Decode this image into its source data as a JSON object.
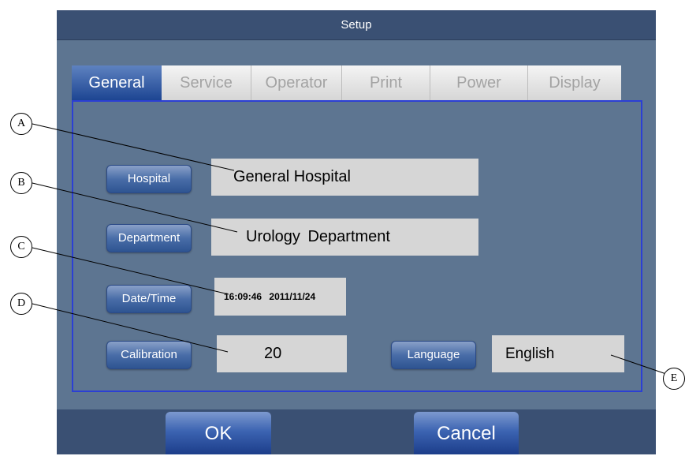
{
  "window": {
    "title": "Setup"
  },
  "tabs": [
    {
      "label": "General",
      "active": true
    },
    {
      "label": "Service",
      "active": false
    },
    {
      "label": "Operator",
      "active": false
    },
    {
      "label": "Print",
      "active": false
    },
    {
      "label": "Power",
      "active": false
    },
    {
      "label": "Display",
      "active": false
    }
  ],
  "general": {
    "hospital_button": "Hospital",
    "hospital_value": "General Hospital",
    "department_button": "Department",
    "department_value_1": "Urology",
    "department_value_2": "Department",
    "datetime_button": "Date/Time",
    "time_value": "16:09:46",
    "date_value": "2011/11/24",
    "calibration_button": "Calibration",
    "calibration_value": "20",
    "language_button": "Language",
    "language_value": "English"
  },
  "footer": {
    "ok_label": "OK",
    "cancel_label": "Cancel"
  },
  "callouts": {
    "a": "A",
    "b": "B",
    "c": "C",
    "d": "D",
    "e": "E"
  },
  "colors": {
    "background": "#5d7591",
    "title_bar": "#3a5073",
    "active_tab": "#2b52a0",
    "panel_border": "#2b3fd4",
    "field": "#d6d6d6"
  }
}
